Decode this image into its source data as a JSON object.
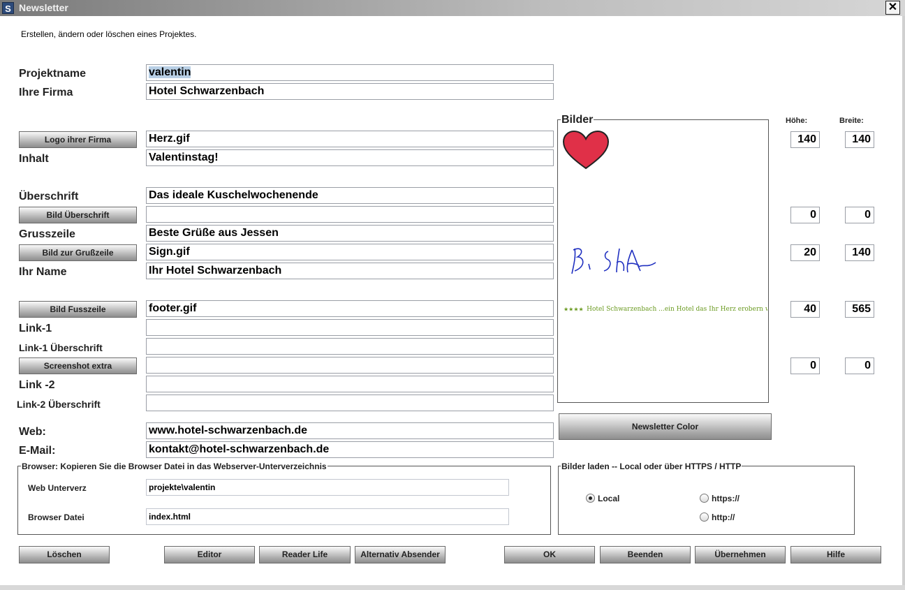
{
  "window": {
    "title": "Newsletter",
    "close_glyph": "✕"
  },
  "description": "Erstellen, ändern oder löschen eines Projektes.",
  "fields": {
    "projektname": {
      "label": "Projektname",
      "value": "valentin"
    },
    "firma": {
      "label": "Ihre Firma",
      "value": "Hotel Schwarzenbach"
    },
    "logo": {
      "button": "Logo ihrer Firma",
      "value": "Herz.gif"
    },
    "inhalt": {
      "label": "Inhalt",
      "value": "Valentinstag!"
    },
    "ueberschrift": {
      "label": "Überschrift",
      "value": "Das ideale Kuschelwochenende"
    },
    "bild_ueberschrift": {
      "button": "Bild Überschrift",
      "value": ""
    },
    "grusszeile": {
      "label": "Grusszeile",
      "value": "Beste Grüße aus Jessen"
    },
    "bild_grusszeile": {
      "button": "Bild zur Grußzeile",
      "value": "Sign.gif"
    },
    "ihr_name": {
      "label": "Ihr Name",
      "value": "Ihr Hotel Schwarzenbach"
    },
    "bild_fusszeile": {
      "button": "Bild Fusszeile",
      "value": "footer.gif"
    },
    "link1": {
      "label": "Link-1",
      "value": ""
    },
    "link1_ueberschrift": {
      "label": "Link-1 Überschrift",
      "value": ""
    },
    "screenshot": {
      "button": "Screenshot extra",
      "value": ""
    },
    "link2": {
      "label": "Link -2",
      "value": ""
    },
    "link2_ueberschrift": {
      "label": "Link-2 Überschrift",
      "value": ""
    },
    "web": {
      "label": "Web:",
      "value": "www.hotel-schwarzenbach.de"
    },
    "email": {
      "label": "E-Mail:",
      "value": "kontakt@hotel-schwarzenbach.de"
    }
  },
  "images": {
    "title": "Bilder",
    "height_label": "Höhe:",
    "width_label": "Breite:",
    "footer_text": "Hotel Schwarzenbach ...ein Hotel das Ihr Herz erobern wird.",
    "rows": [
      {
        "hoehe": "140",
        "breite": "140"
      },
      {
        "hoehe": "0",
        "breite": "0"
      },
      {
        "hoehe": "20",
        "breite": "140"
      },
      {
        "hoehe": "40",
        "breite": "565"
      },
      {
        "hoehe": "0",
        "breite": "0"
      }
    ],
    "color_button": "Newsletter Color"
  },
  "browser": {
    "title": "Browser:  Kopieren Sie die Browser Datei in das Webserver-Unterverzeichnis",
    "web_label": "Web Unterverz",
    "web_value": "projekte\\valentin",
    "file_label": "Browser Datei",
    "file_value": "index.html"
  },
  "laden": {
    "title": "Bilder laden -- Local oder über HTTPS / HTTP",
    "options": [
      {
        "label": "Local",
        "selected": true
      },
      {
        "label": "https://",
        "selected": false
      },
      {
        "label": "http://",
        "selected": false
      }
    ]
  },
  "buttons": {
    "loeschen": "Löschen",
    "editor": "Editor",
    "reader": "Reader Life",
    "alternativ": "Alternativ Absender",
    "ok": "OK",
    "beenden": "Beenden",
    "uebernehmen": "Übernehmen",
    "hilfe": "Hilfe"
  },
  "colors": {
    "heart": "#e03048",
    "signature": "#2030c0",
    "footer_green": "#6a9a20"
  }
}
